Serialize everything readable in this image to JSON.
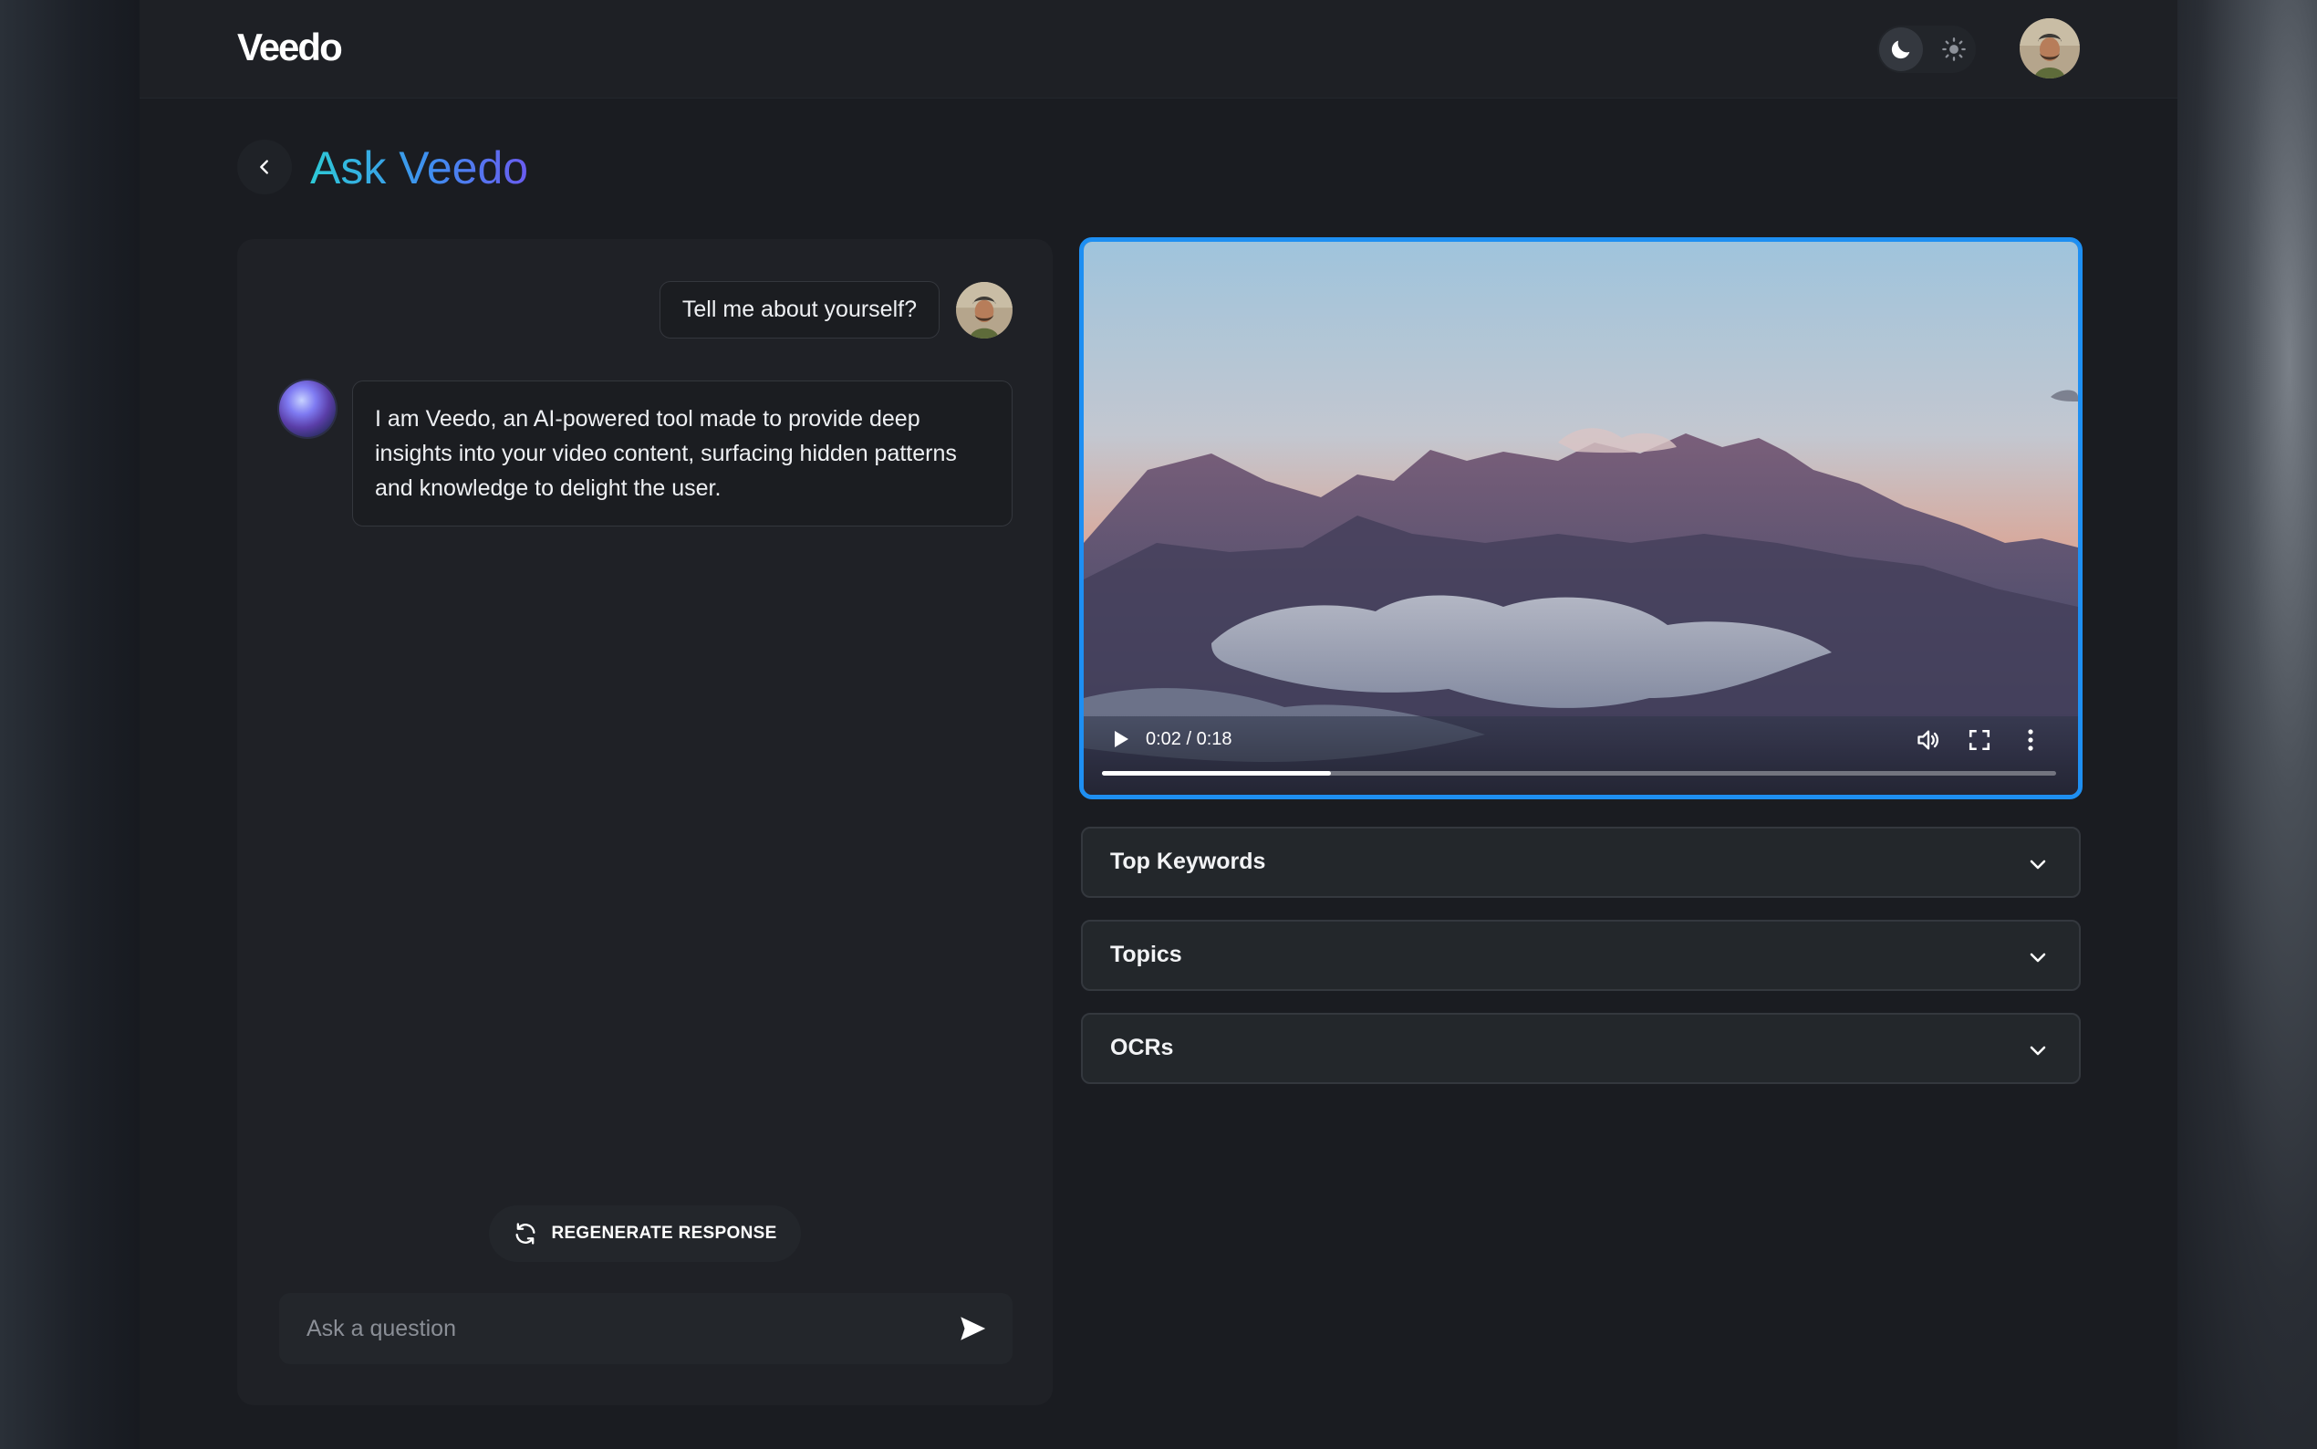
{
  "app": {
    "logo": "Veedo"
  },
  "page": {
    "title": "Ask Veedo"
  },
  "chat": {
    "messages": [
      {
        "role": "user",
        "text": "Tell me about yourself?"
      },
      {
        "role": "assistant",
        "text": "I am Veedo, an AI-powered tool made to provide deep insights into your video content, surfacing hidden patterns and knowledge to delight the user."
      }
    ],
    "regenerate_label": "REGENERATE RESPONSE",
    "input": {
      "placeholder": "Ask a question",
      "value": ""
    }
  },
  "video": {
    "time_display": "0:02 / 0:18",
    "progress_fraction": 0.24
  },
  "panels": [
    {
      "label": "Top Keywords"
    },
    {
      "label": "Topics"
    },
    {
      "label": "OCRs"
    }
  ],
  "colors": {
    "accent": "#1e8ff2",
    "title_gradient": [
      "#2dc9d6",
      "#3f8ef0",
      "#6a5cf0"
    ]
  },
  "icons": {
    "back": "chevron-left-icon",
    "theme_dark": "moon-icon",
    "theme_light": "sun-icon",
    "regenerate": "refresh-icon",
    "send": "send-icon",
    "play": "play-icon",
    "volume": "volume-icon",
    "fullscreen": "fullscreen-icon",
    "more": "more-vertical-icon",
    "expand": "chevron-down-icon"
  }
}
